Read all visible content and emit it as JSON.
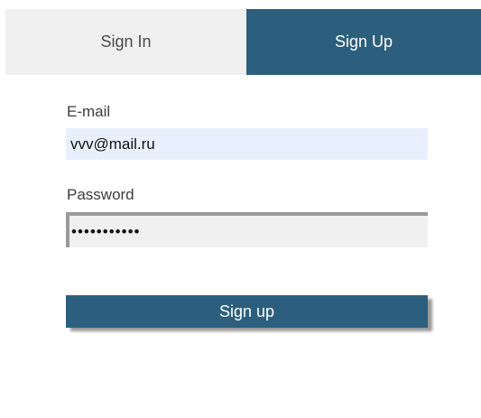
{
  "tabs": {
    "sign_in_label": "Sign In",
    "sign_up_label": "Sign Up",
    "active": "Sign Up"
  },
  "form": {
    "email_label": "E-mail",
    "email_value": "vvv@mail.ru",
    "password_label": "Password",
    "password_value": "12345678901",
    "submit_label": "Sign up"
  },
  "colors": {
    "accent": "#2c5f7d",
    "inactive_tab_bg": "#f0f0f0",
    "autofill_bg": "#e8f0fe"
  }
}
